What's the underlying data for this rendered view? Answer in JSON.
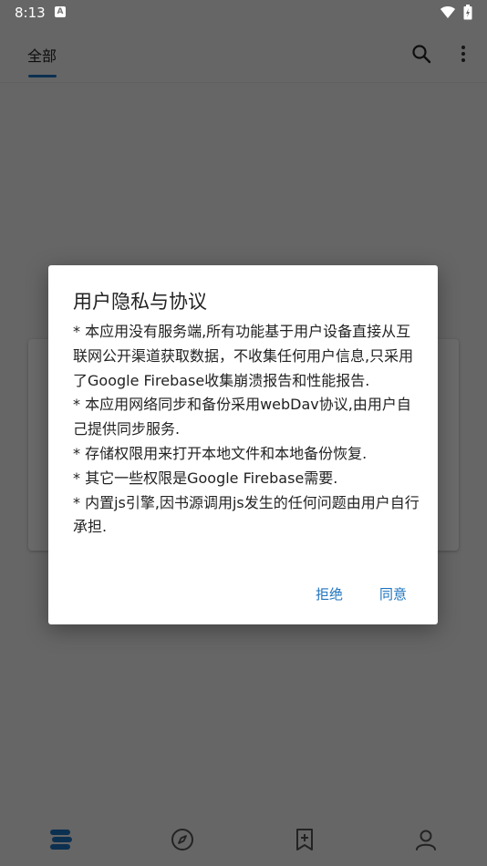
{
  "status_bar": {
    "time": "8:13",
    "notification_icon": "A"
  },
  "app_bar": {
    "tab_label": "全部"
  },
  "dialog": {
    "title": "用户隐私与协议",
    "paragraphs": [
      "* 本应用没有服务端,所有功能基于用户设备直接从互联网公开渠道获取数据，不收集任何用户信息,只采用了Google Firebase收集崩溃报告和性能报告.",
      "* 本应用网络同步和备份采用webDav协议,由用户自己提供同步服务.",
      "* 存储权限用来打开本地文件和本地备份恢复.",
      "* 其它一些权限是Google Firebase需要.",
      "* 内置js引擎,因书源调用js发生的任何问题由用户自行承担."
    ],
    "reject_label": "拒绝",
    "agree_label": "同意"
  },
  "colors": {
    "accent": "#1E73BE",
    "scrim": "rgba(0,0,0,0.58)",
    "background": "#F2F2F2",
    "dialog_bg": "#FFFFFF"
  },
  "icons": {
    "status": [
      "wifi-icon",
      "battery-icon"
    ],
    "app_bar": [
      "search-icon",
      "more-vert-icon"
    ],
    "bottom_nav": [
      "bookshelf-icon",
      "compass-icon",
      "bookmark-add-icon",
      "person-icon"
    ]
  }
}
